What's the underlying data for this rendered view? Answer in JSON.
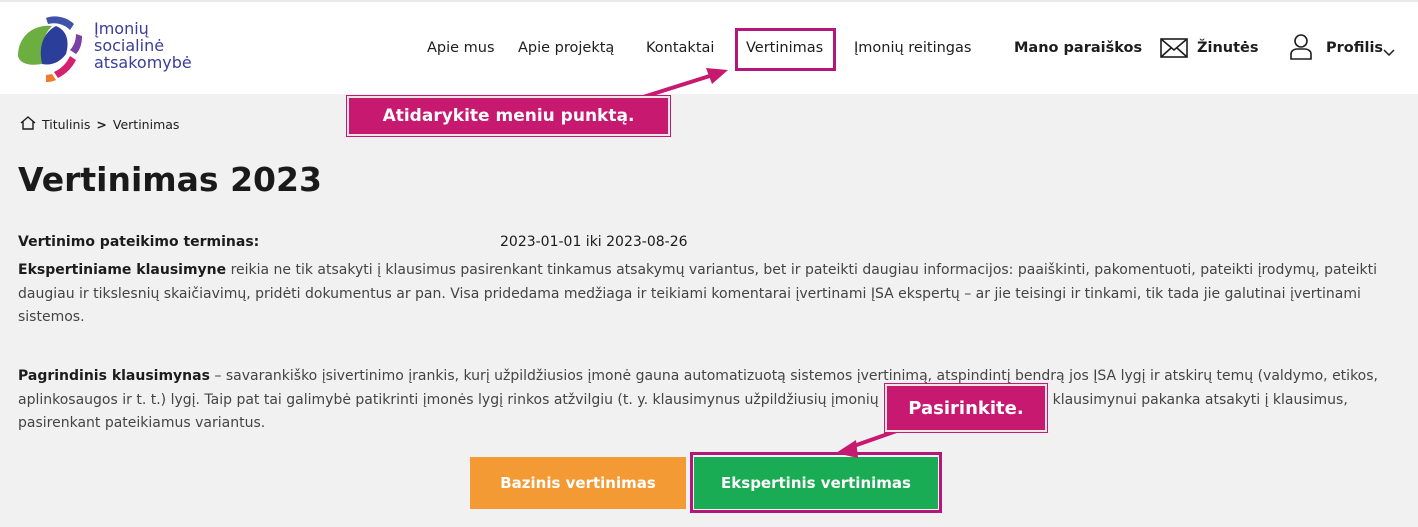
{
  "logo": {
    "lines": [
      "Įmonių",
      "socialinė",
      "atsakomybė"
    ],
    "colors": {
      "green": "#6cae3f",
      "blue": "#2b3f9a",
      "orange": "#f27a2d",
      "pink": "#d4206f",
      "purple": "#7b3fa5"
    }
  },
  "nav": {
    "items": [
      "Apie mus",
      "Apie projektą",
      "Kontaktai",
      "Vertinimas",
      "Įmonių reitingas"
    ],
    "applications": "Mano paraiškos",
    "messages": "Žinutės",
    "profile": "Profilis"
  },
  "callouts": {
    "menu": "Atidarykite meniu punktą.",
    "choose": "Pasirinkite."
  },
  "breadcrumb": {
    "home": "Titulinis",
    "separator": ">",
    "current": "Vertinimas"
  },
  "page_title": "Vertinimas 2023",
  "term": {
    "label": "Vertinimo pateikimo terminas:",
    "value": "2023-01-01 iki 2023-08-26"
  },
  "paragraph1": {
    "bold": "Ekspertiniame klausimyne",
    "text": " reikia ne tik atsakyti į klausimus pasirenkant tinkamus atsakymų variantus, bet ir pateikti daugiau informacijos: paaiškinti, pakomentuoti, pateikti įrodymų, pateikti daugiau ir tikslesnių skaičiavimų, pridėti dokumentus ar pan. Visa pridedama medžiaga ir teikiami komentarai įvertinami ĮSA ekspertų – ar jie teisingi ir tinkami, tik tada jie galutinai įvertinami sistemos."
  },
  "paragraph2": {
    "bold": "Pagrindinis klausimynas",
    "text": " – savarankiško įsivertinimo įrankis, kurį užpildžiusios įmonė gauna automatizuotą sistemos įvertinimą, atspindintį bendrą jos ĮSA lygį ir atskirų temų (valdymo, etikos, aplinkosaugos ir t. t.) lygį. Taip pat tai galimybė patikrinti įmonės lygį rinkos atžvilgiu (t. y. klausimynus užpildžiusių įmonių atžvilgiu). Pagrindiniam klausimynui pakanka atsakyti į klausimus, pasirenkant pateikiamus variantus."
  },
  "buttons": {
    "basic": "Bazinis vertinimas",
    "expert": "Ekspertinis vertinimas"
  },
  "colors": {
    "accent_magenta": "#c6196f",
    "highlight_border": "#b4167a",
    "orange_button": "#f49a34",
    "green_button": "#1aab55"
  }
}
